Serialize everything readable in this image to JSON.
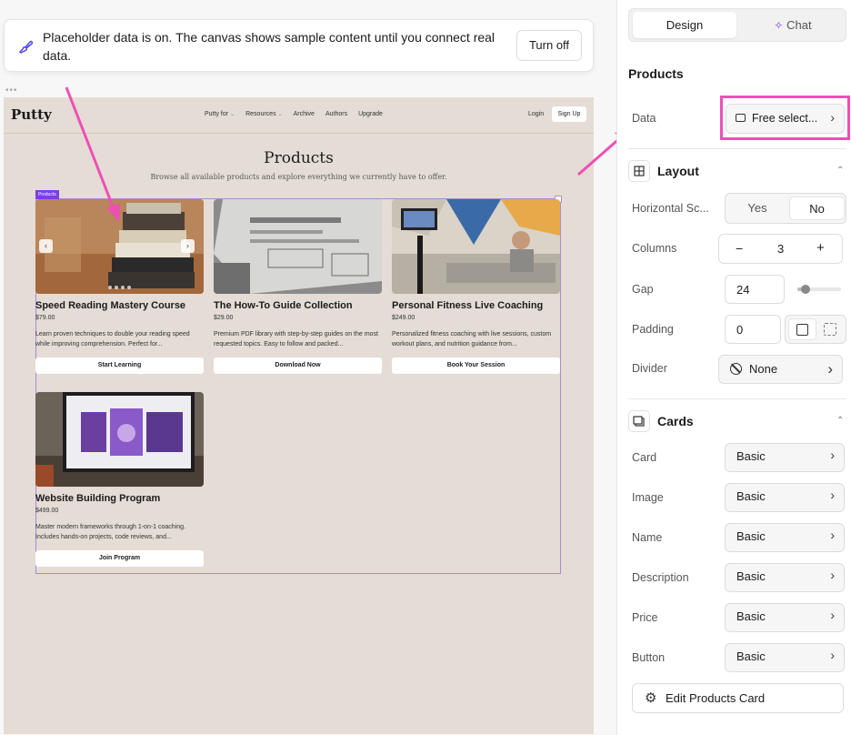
{
  "toast": {
    "message": "Placeholder data is on. The canvas shows sample content until you connect real data.",
    "button": "Turn off"
  },
  "site": {
    "logo": "Putty",
    "nav": [
      {
        "label": "Putty for",
        "dropdown": true
      },
      {
        "label": "Resources",
        "dropdown": true
      },
      {
        "label": "Archive",
        "dropdown": false
      },
      {
        "label": "Authors",
        "dropdown": false
      },
      {
        "label": "Upgrade",
        "dropdown": false
      }
    ],
    "login": "Login",
    "signup": "Sign Up",
    "title": "Products",
    "subtitle": "Browse all available products and explore everything we currently have to offer.",
    "selection_tag": "Products",
    "products": [
      {
        "name": "Speed Reading Mastery Course",
        "price": "$79.00",
        "description": "Learn proven techniques to double your reading speed while improving comprehension. Perfect for...",
        "cta": "Start Learning"
      },
      {
        "name": "The How-To Guide Collection",
        "price": "$29.00",
        "description": "Premium PDF library with step-by-step guides on the most requested topics. Easy to follow and packed...",
        "cta": "Download Now"
      },
      {
        "name": "Personal Fitness Live Coaching",
        "price": "$249.00",
        "description": "Personalized fitness coaching with live sessions, custom workout plans, and nutrition guidance from...",
        "cta": "Book Your Session"
      },
      {
        "name": "Website Building Program",
        "price": "$499.00",
        "description": "Master modern frameworks through 1-on-1 coaching. Includes hands-on projects, code reviews, and...",
        "cta": "Join Program"
      }
    ]
  },
  "panel": {
    "tabs": {
      "design": "Design",
      "chat": "Chat"
    },
    "section_title": "Products",
    "data_label": "Data",
    "data_value": "Free select...",
    "layout": {
      "title": "Layout",
      "horizontal_scroll_label": "Horizontal Sc...",
      "yes": "Yes",
      "no": "No",
      "columns_label": "Columns",
      "columns_value": "3",
      "minus": "−",
      "plus": "+",
      "gap_label": "Gap",
      "gap_value": "24",
      "gap_slider_level": 0.1,
      "padding_label": "Padding",
      "padding_value": "0",
      "divider_label": "Divider",
      "divider_value": "None"
    },
    "cards": {
      "title": "Cards",
      "rows": [
        {
          "label": "Card",
          "value": "Basic"
        },
        {
          "label": "Image",
          "value": "Basic"
        },
        {
          "label": "Name",
          "value": "Basic"
        },
        {
          "label": "Description",
          "value": "Basic"
        },
        {
          "label": "Price",
          "value": "Basic"
        },
        {
          "label": "Button",
          "value": "Basic"
        }
      ],
      "edit_button": "Edit Products Card"
    }
  },
  "colors": {
    "annotation": "#ee4fb5",
    "selection": "#7b3fe4",
    "canvas_bg": "#e4dcd5"
  }
}
